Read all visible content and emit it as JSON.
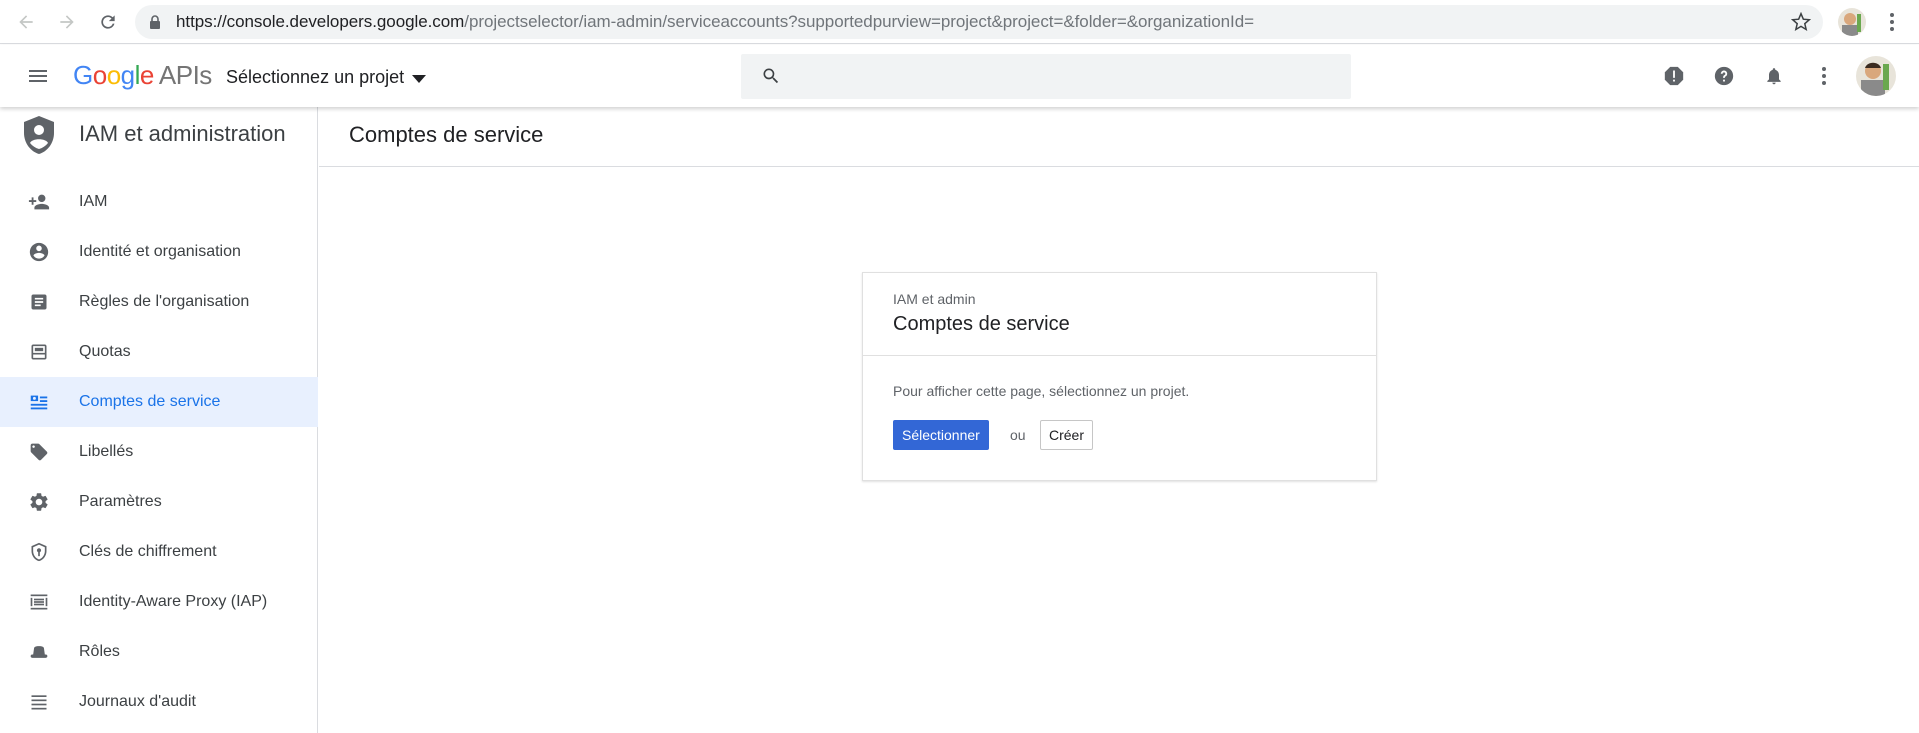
{
  "browser": {
    "url_host": "https://console.developers.google.com",
    "url_path": "/projectselector/iam-admin/serviceaccounts?supportedpurview=project&project=&folder=&organizationId="
  },
  "header": {
    "logo_letters": [
      "G",
      "o",
      "o",
      "g",
      "l",
      "e"
    ],
    "logo_colors": [
      "#4285f4",
      "#ea4335",
      "#fbbc05",
      "#4285f4",
      "#34a853",
      "#ea4335"
    ],
    "logo_suffix": "APIs",
    "project_selector_label": "Sélectionnez un projet",
    "search_placeholder": "",
    "icons": [
      "feedback-icon",
      "help-icon",
      "notifications-icon",
      "more-vert-icon"
    ]
  },
  "sidebar": {
    "title": "IAM et administration",
    "items": [
      {
        "label": "IAM",
        "icon": "person-add-icon",
        "active": false
      },
      {
        "label": "Identité et organisation",
        "icon": "account-circle-icon",
        "active": false
      },
      {
        "label": "Règles de l'organisation",
        "icon": "policy-doc-icon",
        "active": false
      },
      {
        "label": "Quotas",
        "icon": "quota-icon",
        "active": false
      },
      {
        "label": "Comptes de service",
        "icon": "service-account-icon",
        "active": true
      },
      {
        "label": "Libellés",
        "icon": "label-icon",
        "active": false
      },
      {
        "label": "Paramètres",
        "icon": "settings-icon",
        "active": false
      },
      {
        "label": "Clés de chiffrement",
        "icon": "encryption-key-icon",
        "active": false
      },
      {
        "label": "Identity-Aware Proxy (IAP)",
        "icon": "iap-icon",
        "active": false
      },
      {
        "label": "Rôles",
        "icon": "roles-icon",
        "active": false
      },
      {
        "label": "Journaux d'audit",
        "icon": "audit-logs-icon",
        "active": false
      }
    ]
  },
  "main": {
    "page_title": "Comptes de service",
    "card": {
      "subtitle": "IAM et admin",
      "title": "Comptes de service",
      "message": "Pour afficher cette page, sélectionnez un projet.",
      "primary_button": "Sélectionner",
      "or_text": "ou",
      "secondary_button": "Créer"
    }
  },
  "colors": {
    "accent": "#1a73e8",
    "primary_button": "#3367d6",
    "active_bg": "#e8f0fe"
  }
}
